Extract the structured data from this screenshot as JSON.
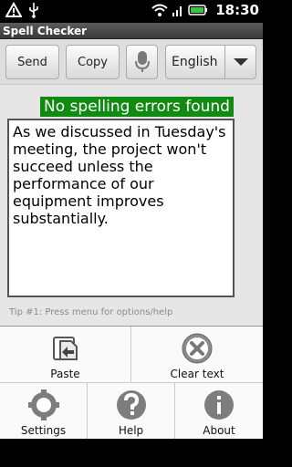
{
  "status_bar": {
    "time": "18:30"
  },
  "app": {
    "title": "Spell Checker"
  },
  "toolbar": {
    "send_label": "Send",
    "copy_label": "Copy",
    "language": "English"
  },
  "result": {
    "message": "No spelling errors found",
    "color": "#108a10"
  },
  "editor": {
    "text": "As we discussed in Tuesday's meeting, the project won't succeed unless the performance of our equipment improves substantially."
  },
  "tip": "Tip #1: Press menu for options/help",
  "menu": {
    "paste": "Paste",
    "clear": "Clear text",
    "settings": "Settings",
    "help": "Help",
    "about": "About"
  }
}
